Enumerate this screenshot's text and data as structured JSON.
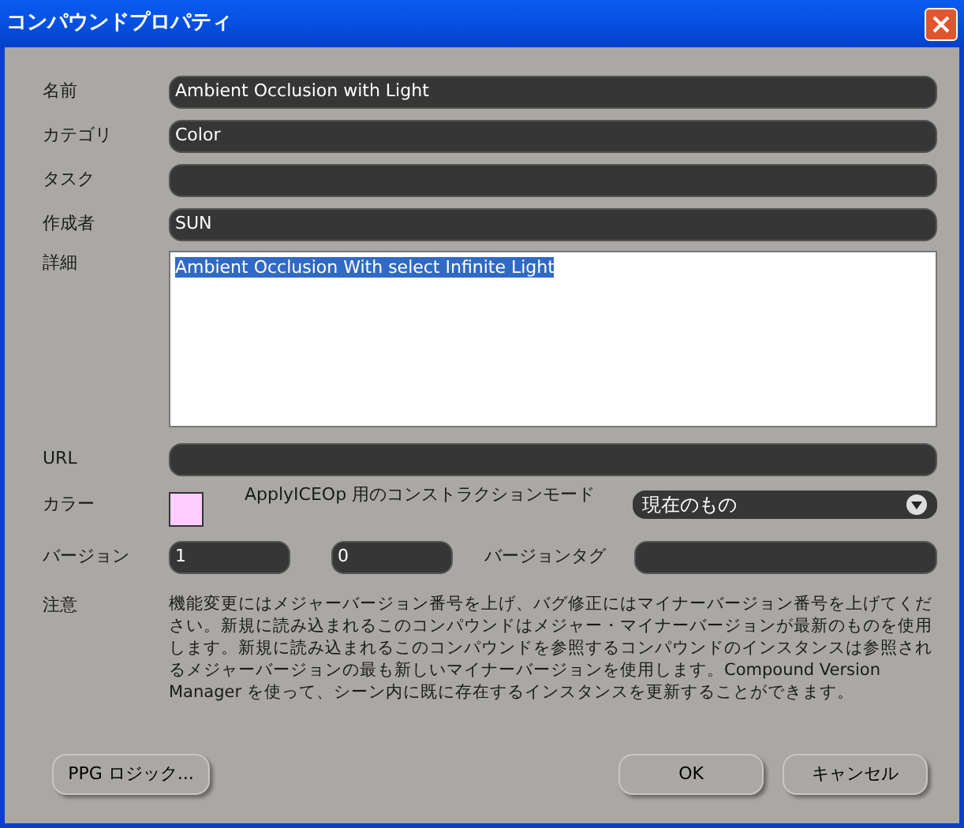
{
  "window": {
    "title": "コンパウンドプロパティ"
  },
  "fields": [
    {
      "label": "名前",
      "value": "Ambient Occlusion with Light"
    },
    {
      "label": "カテゴリ",
      "value": "Color"
    },
    {
      "label": "タスク"
    },
    {
      "label": "作成者",
      "value": "SUN"
    }
  ],
  "details": {
    "label": "詳細",
    "value": "Ambient Occlusion With select Infinite Light",
    "selected": true
  },
  "url": {
    "label": "URL"
  },
  "color": {
    "label": "カラー",
    "color": "#ffccff"
  },
  "construction_mode": {
    "label": "ApplyICEOp 用のコンストラクションモード",
    "value": "現在のもの"
  },
  "version": {
    "label": "バージョン",
    "major": "1",
    "minor": "0",
    "tag_label": "バージョンタグ"
  },
  "notes": {
    "label": "注意",
    "text": "機能変更にはメジャーバージョン番号を上げ、バグ修正にはマイナーバージョン番号を上げてください。新規に読み込まれるこのコンパウンドはメジャー・マイナーバージョンが最新のものを使用します。新規に読み込まれるこのコンパウンドを参照するコンパウンドのインスタンスは参照されるメジャーバージョンの最も新しいマイナーバージョンを使用します。Compound Version Manager を使って、シーン内に既に存在するインスタンスを更新することができます。"
  },
  "buttons": {
    "logic": "PPG ロジック...",
    "ok": "OK",
    "cancel": "キャンセル"
  }
}
